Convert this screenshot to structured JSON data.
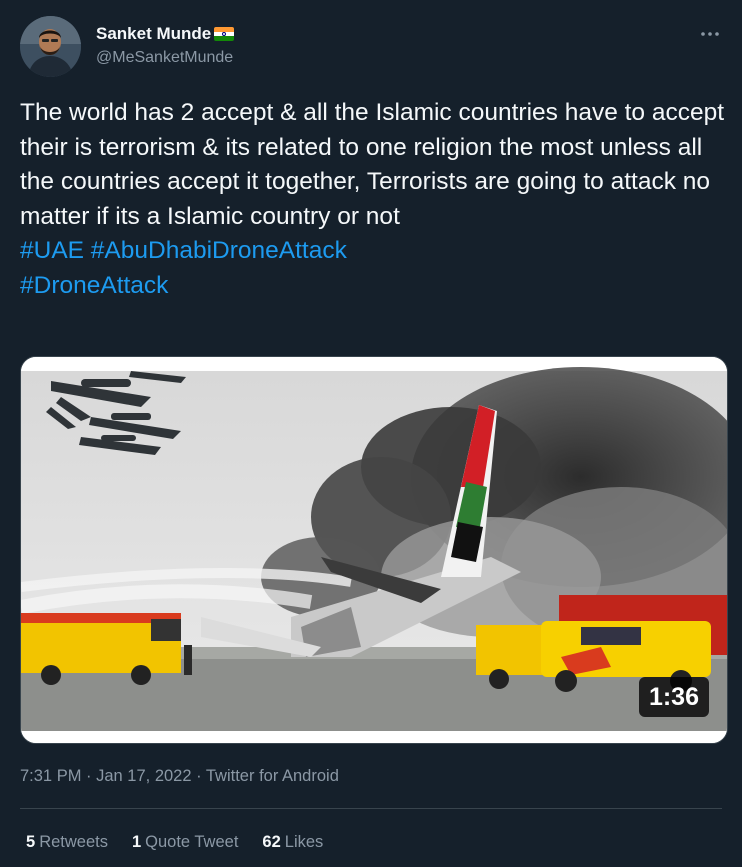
{
  "author": {
    "display_name": "Sanket Munde",
    "flag_icon": "india-flag-icon",
    "handle": "@MeSanketMunde"
  },
  "more_icon": "more-icon",
  "tweet": {
    "text": "The world has 2 accept & all the Islamic countries have to accept their is terrorism & its related to one religion the most unless all the countries accept it together, Terrorists are going to attack no matter if its a Islamic country or not",
    "hashtags_line1": "#UAE #AbuDhabiDroneAttack",
    "hashtags_line2": "#DroneAttack"
  },
  "media": {
    "type": "video",
    "duration": "1:36"
  },
  "meta": {
    "timestamp": "7:31 PM · Jan 17, 2022 · Twitter for Android"
  },
  "stats": {
    "retweets_count": "5",
    "retweets_label": "Retweets",
    "quotes_count": "1",
    "quotes_label": "Quote Tweet",
    "likes_count": "62",
    "likes_label": "Likes"
  },
  "colors": {
    "background": "#15202b",
    "link": "#1d9bf0",
    "secondary_text": "#8b98a5",
    "divider": "#38444d"
  }
}
